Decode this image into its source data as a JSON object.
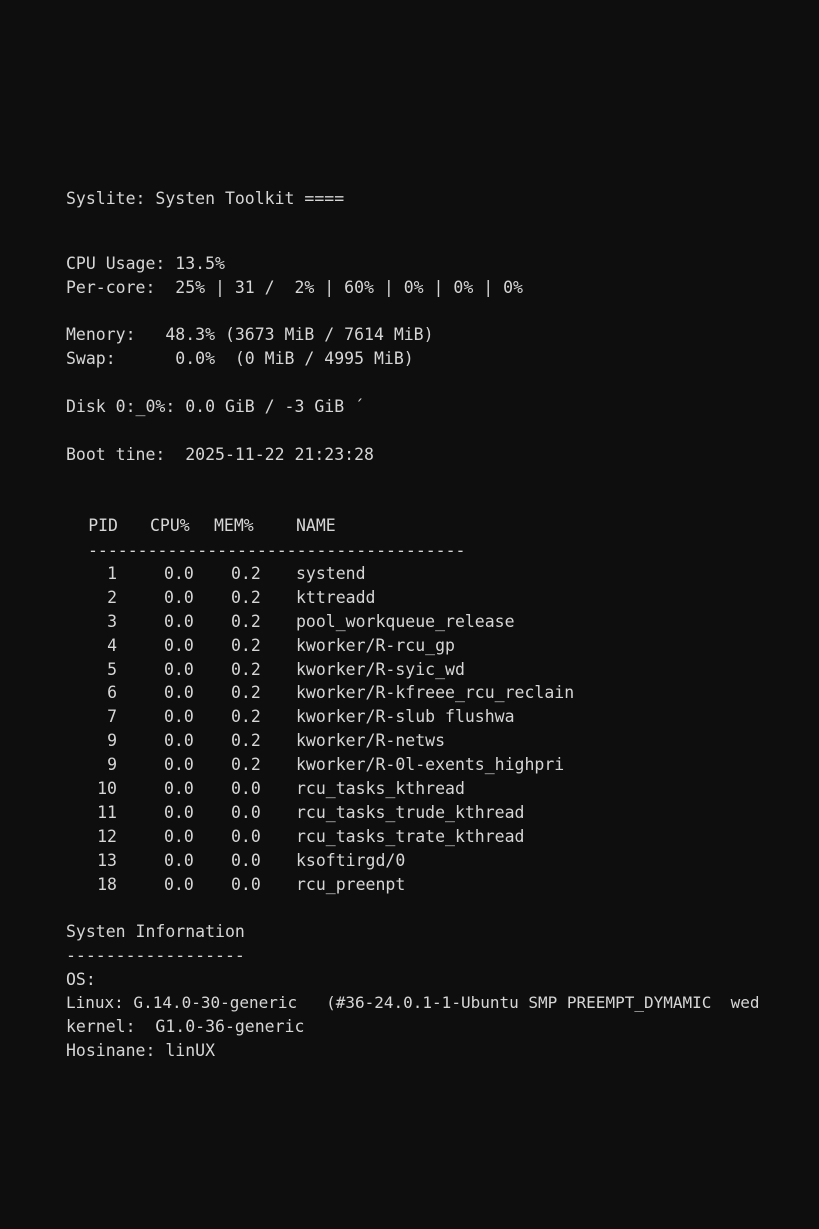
{
  "header": {
    "title": "Syslite: Systen Toolkit ===="
  },
  "cpu": {
    "usage_line": "CPU Usage: 13.5%",
    "per_core_line": "Per-core:  25% | 31 /  2% | 60% | 0% | 0% | 0%"
  },
  "memory": {
    "memory_line": "Menory:   48.3% (3673 MiB / 7614 MiB)",
    "swap_line": "Swap:      0.0%  (0 MiB / 4995 MiB)"
  },
  "disk": {
    "disk_line": "Disk 0:_0%: 0.0 GiB / -3 GiB ´"
  },
  "boot": {
    "boot_line": "Boot tine:  2025-11-22 21:23:28"
  },
  "process_table": {
    "headers": {
      "pid": "PID",
      "cpu": "CPU%",
      "mem": "MEM%",
      "name": "NAME"
    },
    "separator": "--------------------------------------",
    "rows": [
      {
        "pid": "1",
        "cpu": "0.0",
        "mem": "0.2",
        "name": "systend"
      },
      {
        "pid": "2",
        "cpu": "0.0",
        "mem": "0.2",
        "name": "kttreadd"
      },
      {
        "pid": "3",
        "cpu": "0.0",
        "mem": "0.2",
        "name": "pool_workqueue_release"
      },
      {
        "pid": "4",
        "cpu": "0.0",
        "mem": "0.2",
        "name": "kworker/R-rcu_gp"
      },
      {
        "pid": "5",
        "cpu": "0.0",
        "mem": "0.2",
        "name": "kworker/R-syic_wd"
      },
      {
        "pid": "6",
        "cpu": "0.0",
        "mem": "0.2",
        "name": "kworker/R-kfreee_rcu_reclain"
      },
      {
        "pid": "7",
        "cpu": "0.0",
        "mem": "0.2",
        "name": "kworker/R-slub flushwa"
      },
      {
        "pid": "9",
        "cpu": "0.0",
        "mem": "0.2",
        "name": "kworker/R-netws"
      },
      {
        "pid": "9",
        "cpu": "0.0",
        "mem": "0.2",
        "name": "kworker/R-0l-exents_highpri"
      },
      {
        "pid": "10",
        "cpu": "0.0",
        "mem": "0.0",
        "name": "rcu_tasks_kthread"
      },
      {
        "pid": "11",
        "cpu": "0.0",
        "mem": "0.0",
        "name": "rcu_tasks_trude_kthread"
      },
      {
        "pid": "12",
        "cpu": "0.0",
        "mem": "0.0",
        "name": "rcu_tasks_trate_kthread"
      },
      {
        "pid": "13",
        "cpu": "0.0",
        "mem": "0.0",
        "name": "ksoftirgd/0"
      },
      {
        "pid": "18",
        "cpu": "0.0",
        "mem": "0.0",
        "name": "rcu_preenpt"
      }
    ]
  },
  "system_info": {
    "title": "Systen Infornation",
    "separator": "------------------",
    "os_label": "OS:",
    "linux_line": "Linux: G.14.0-30-generic   (#36-24.0.1-1-Ubuntu SMP PREEMPT_DYMAMIC  wed",
    "kernel_line": "kernel:  G1.0-36-generic",
    "hostname_line": "Hosinane: linUX"
  }
}
